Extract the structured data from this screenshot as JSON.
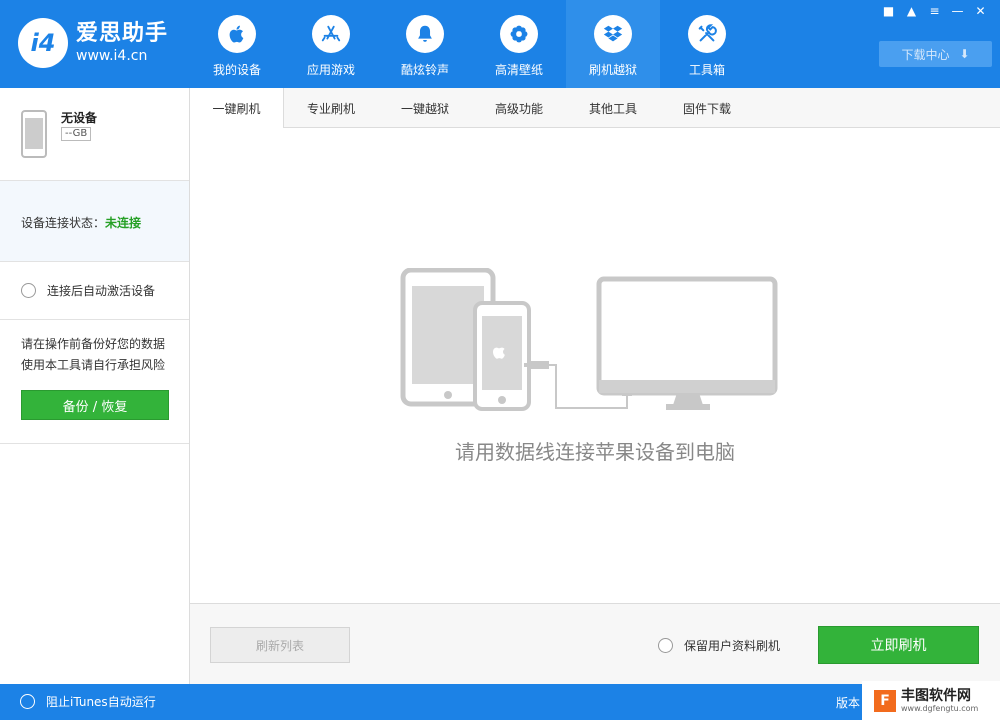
{
  "app": {
    "logo_letter": "i4",
    "name": "爱思助手",
    "url": "www.i4.cn"
  },
  "nav": [
    {
      "label": "我的设备",
      "icon": "apple-icon"
    },
    {
      "label": "应用游戏",
      "icon": "app-store-icon"
    },
    {
      "label": "酷炫铃声",
      "icon": "bell-icon"
    },
    {
      "label": "高清壁纸",
      "icon": "flower-icon"
    },
    {
      "label": "刷机越狱",
      "icon": "dropbox-box-icon"
    },
    {
      "label": "工具箱",
      "icon": "tools-icon"
    }
  ],
  "window_controls": [
    "message-icon",
    "skin-icon",
    "menu-icon",
    "minimize-icon",
    "close-icon"
  ],
  "download_center": {
    "label": "下载中心",
    "icon": "download-icon"
  },
  "sidebar": {
    "device_name": "无设备",
    "device_capacity": "--GB",
    "status_label": "设备连接状态：",
    "status_value": "未连接",
    "auto_activate": "连接后自动激活设备",
    "warning_line1": "请在操作前备份好您的数据",
    "warning_line2": "使用本工具请自行承担风险",
    "backup_button": "备份 / 恢复"
  },
  "tabs": [
    "一键刷机",
    "专业刷机",
    "一键越狱",
    "高级功能",
    "其他工具",
    "固件下载"
  ],
  "content": {
    "hint": "请用数据线连接苹果设备到电脑"
  },
  "bottom": {
    "refresh_button": "刷新列表",
    "keep_data": "保留用户资料刷机",
    "flash_button": "立即刷机"
  },
  "statusbar": {
    "itunes": "阻止iTunes自动运行",
    "version": "版本"
  },
  "watermark": {
    "logo": "F",
    "name": "丰图软件网",
    "url": "www.dgfengtu.com"
  },
  "colors": {
    "brand_blue": "#1c82e6",
    "green": "#33b33a",
    "status_green": "#26a026"
  }
}
